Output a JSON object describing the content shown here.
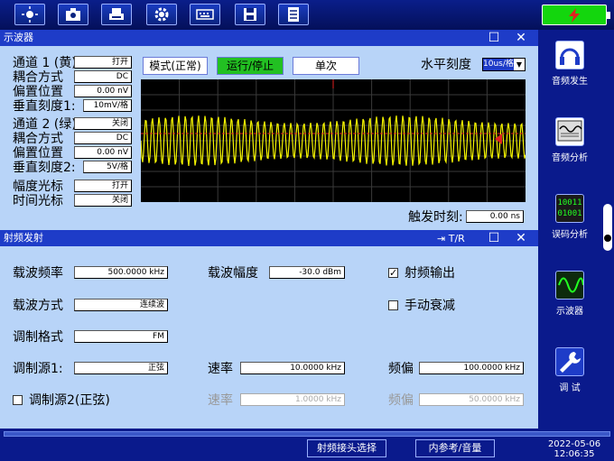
{
  "toolbar": {
    "icons": [
      "brightness-icon",
      "camera-icon",
      "printer-icon",
      "settings-icon",
      "keyboard-icon",
      "save-icon",
      "notes-icon"
    ]
  },
  "battery": {
    "icon": "charging-icon",
    "color": "#13d60d"
  },
  "osc": {
    "title": "示波器",
    "ch1": {
      "label": "通道 1 (黄):",
      "value": "打开"
    },
    "coupling1": {
      "label": "耦合方式",
      "value": "DC"
    },
    "offset1": {
      "label": "偏置位置",
      "value": "0.00 nV"
    },
    "vscale1": {
      "label": "垂直刻度1:",
      "value": "10mV/格"
    },
    "ch2": {
      "label": "通道 2 (绿):",
      "value": "关闭"
    },
    "coupling2": {
      "label": "耦合方式",
      "value": "DC"
    },
    "offset2": {
      "label": "偏置位置",
      "value": "0.00 nV"
    },
    "vscale2": {
      "label": "垂直刻度2:",
      "value": "5V/格"
    },
    "ampcursor": {
      "label": "幅度光标",
      "value": "打开"
    },
    "timecursor": {
      "label": "时间光标",
      "value": "关闭"
    },
    "mode_btn": "模式(正常)",
    "run_btn": "运行/停止",
    "single_btn": "单次",
    "hscale": {
      "label": "水平刻度",
      "value": "10us/格"
    },
    "trigger": {
      "label": "触发时刻:",
      "value": "0.00 ns"
    },
    "waveform_colors": {
      "ch1": "#f5f500",
      "marker": "#e02020",
      "grid": "#3a3a3a"
    }
  },
  "rf": {
    "title": "射频发射",
    "tr_label": "T/R",
    "carrier_freq": {
      "label": "载波频率",
      "value": "500.0000 kHz"
    },
    "carrier_amp": {
      "label": "载波幅度",
      "value": "-30.0 dBm"
    },
    "rf_output": {
      "label": "射频输出",
      "checked": true
    },
    "carrier_mode": {
      "label": "载波方式",
      "value": "连续波"
    },
    "manual_atten": {
      "label": "手动衰减",
      "checked": false
    },
    "mod_format": {
      "label": "调制格式",
      "value": "FM"
    },
    "mod_src1": {
      "label": "调制源1:",
      "value": "正弦"
    },
    "rate1": {
      "label": "速率",
      "value": "10.0000 kHz"
    },
    "dev1": {
      "label": "频偏",
      "value": "100.0000 kHz"
    },
    "mod_src2": {
      "label": "调制源2(正弦)",
      "checked": false
    },
    "rate2": {
      "label": "速率",
      "value": "1.0000 kHz"
    },
    "dev2": {
      "label": "频偏",
      "value": "50.0000 kHz"
    }
  },
  "sidebar": [
    {
      "label": "音频发生",
      "icon": "headphones-icon"
    },
    {
      "label": "音频分析",
      "icon": "audio-analysis-icon"
    },
    {
      "label": "误码分析",
      "icon": "bit-error-icon"
    },
    {
      "label": "示波器",
      "icon": "oscilloscope-icon"
    },
    {
      "label": "调  试",
      "icon": "wrench-icon"
    }
  ],
  "bottom": {
    "rf_connector_btn": "射频接头选择",
    "ref_volume_btn": "内参考/音量",
    "date": "2022-05-06",
    "time": "12:06:35"
  }
}
